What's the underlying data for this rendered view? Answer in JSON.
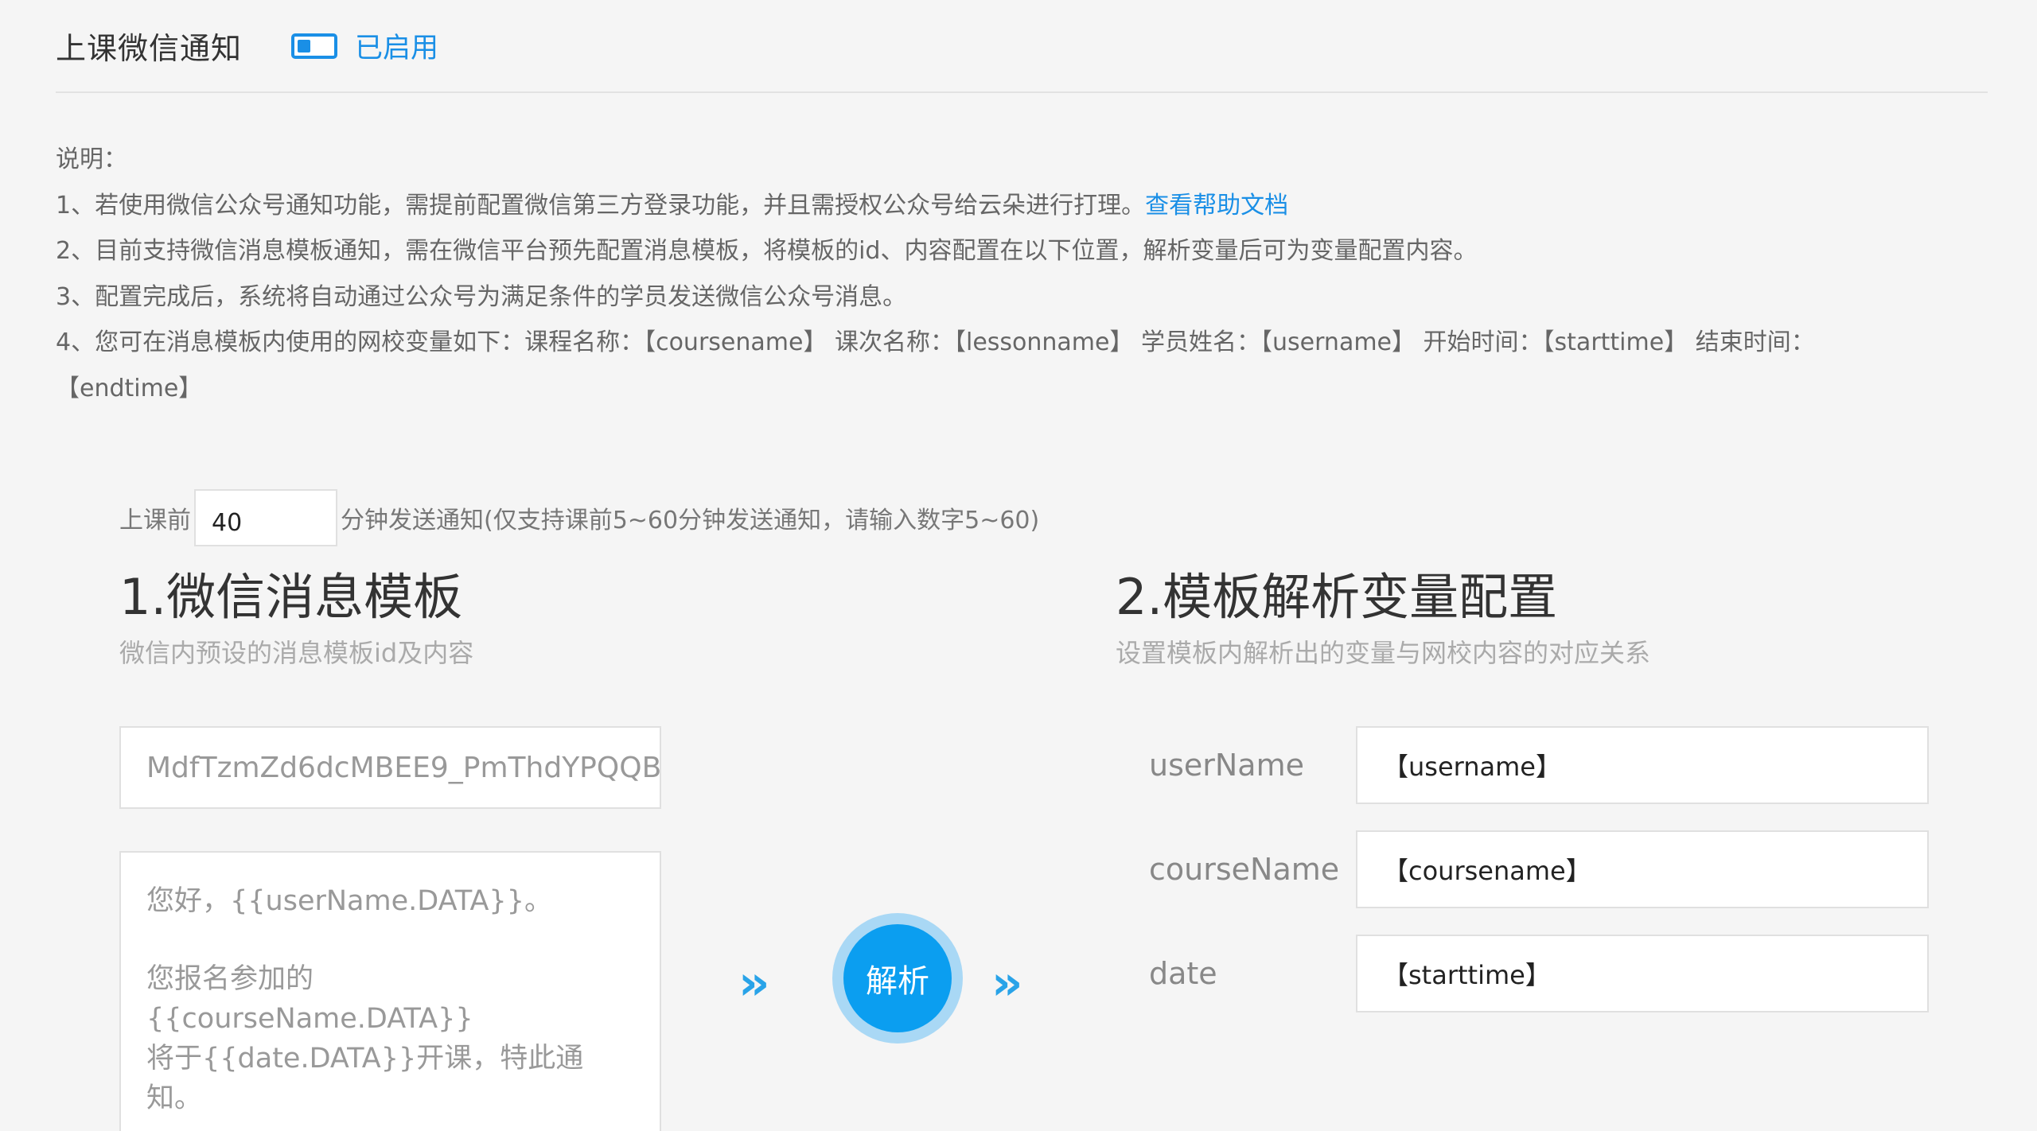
{
  "header": {
    "title": "上课微信通知",
    "status": "已启用",
    "enabled": true
  },
  "notes": {
    "heading": "说明：",
    "line1_text": "1、若使用微信公众号通知功能，需提前配置微信第三方登录功能，并且需授权公众号给云朵进行打理。",
    "line1_link": "查看帮助文档",
    "line2": "2、目前支持微信消息模板通知，需在微信平台预先配置消息模板，将模板的id、内容配置在以下位置，解析变量后可为变量配置内容。",
    "line3": "3、配置完成后，系统将自动通过公众号为满足条件的学员发送微信公众号消息。",
    "line4": "4、您可在消息模板内使用的网校变量如下：课程名称：【coursename】 课次名称：【lessonname】 学员姓名：【username】 开始时间：【starttime】 结束时间：",
    "line5": "【endtime】"
  },
  "minutes": {
    "prefix": "上课前",
    "value": "40",
    "suffix": "分钟发送通知(仅支持课前5~60分钟发送通知，请输入数字5~60)"
  },
  "template": {
    "title": "1.微信消息模板",
    "subtitle": "微信内预设的消息模板id及内容",
    "id_value": "MdfTzmZd6dcMBEE9_PmThdYPQQB",
    "content_line1": "您好，{{userName.DATA}}。",
    "content_line2": "您报名参加的{{courseName.DATA}}",
    "content_line3": "将于{{date.DATA}}开课，特此通知。"
  },
  "parse": {
    "arrow_left": "››",
    "label": "解析",
    "arrow_right": "››"
  },
  "variables": {
    "title": "2.模板解析变量配置",
    "subtitle": "设置模板内解析出的变量与网校内容的对应关系",
    "items": [
      {
        "name": "userName",
        "value": "【username】"
      },
      {
        "name": "courseName",
        "value": "【coursename】"
      },
      {
        "name": "date",
        "value": "【starttime】"
      }
    ]
  },
  "colors": {
    "accent": "#1a8fe6",
    "button": "#0b9ef0",
    "background": "#f5f5f5"
  }
}
